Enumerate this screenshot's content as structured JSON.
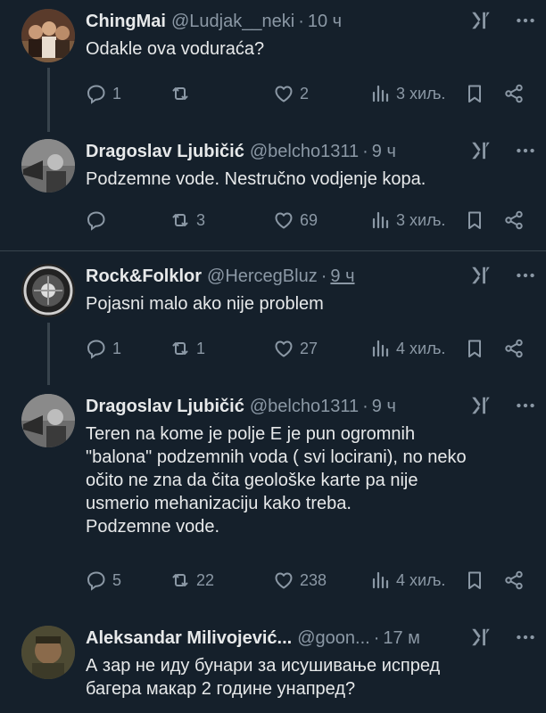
{
  "tweets": [
    {
      "name": "ChingMai",
      "handle": "@Ludjak__neki",
      "time": "10 ч",
      "text": [
        "Odakle ova voduraća?"
      ],
      "replies": "1",
      "retweets": "",
      "likes": "2",
      "views": "3 хиљ."
    },
    {
      "name": "Dragoslav Ljubičić",
      "handle": "@belcho1311",
      "time": "9 ч",
      "text": [
        "Podzemne vode. Nestručno vodjenje kopa."
      ],
      "replies": "",
      "retweets": "3",
      "likes": "69",
      "views": "3 хиљ."
    },
    {
      "name": "Rock&Folklor",
      "handle": "@HercegBluz",
      "time": "9 ч",
      "text": [
        "Pojasni malo ako nije problem"
      ],
      "replies": "1",
      "retweets": "1",
      "likes": "27",
      "views": "4 хиљ."
    },
    {
      "name": "Dragoslav Ljubičić",
      "handle": "@belcho1311",
      "time": "9 ч",
      "text": [
        "Teren na kome je polje E je pun ogromnih",
        "\"balona\" podzemnih voda ( svi locirani), no neko",
        "očito ne zna da čita geološke karte pa nije",
        "usmerio mehanizaciju kako treba.",
        "Podzemne vode."
      ],
      "replies": "5",
      "retweets": "22",
      "likes": "238",
      "views": "4 хиљ."
    },
    {
      "name": "Aleksandar Milivojević...",
      "handle": "@goon...",
      "time": "17 м",
      "text": [
        "А зар не иду бунари за исушивање испред",
        "багера макар 2 године унапред?"
      ]
    }
  ],
  "separator": "·",
  "icons": {
    "reply": "reply-icon",
    "retweet": "retweet-icon",
    "like": "heart-icon",
    "views": "views-icon",
    "bookmark": "bookmark-icon",
    "share": "share-icon",
    "grok": "grok-icon",
    "more": "more-icon"
  },
  "colors": {
    "background": "#15202b",
    "text": "#e7e9ea",
    "muted": "#8b98a5",
    "divider": "#38444d"
  }
}
